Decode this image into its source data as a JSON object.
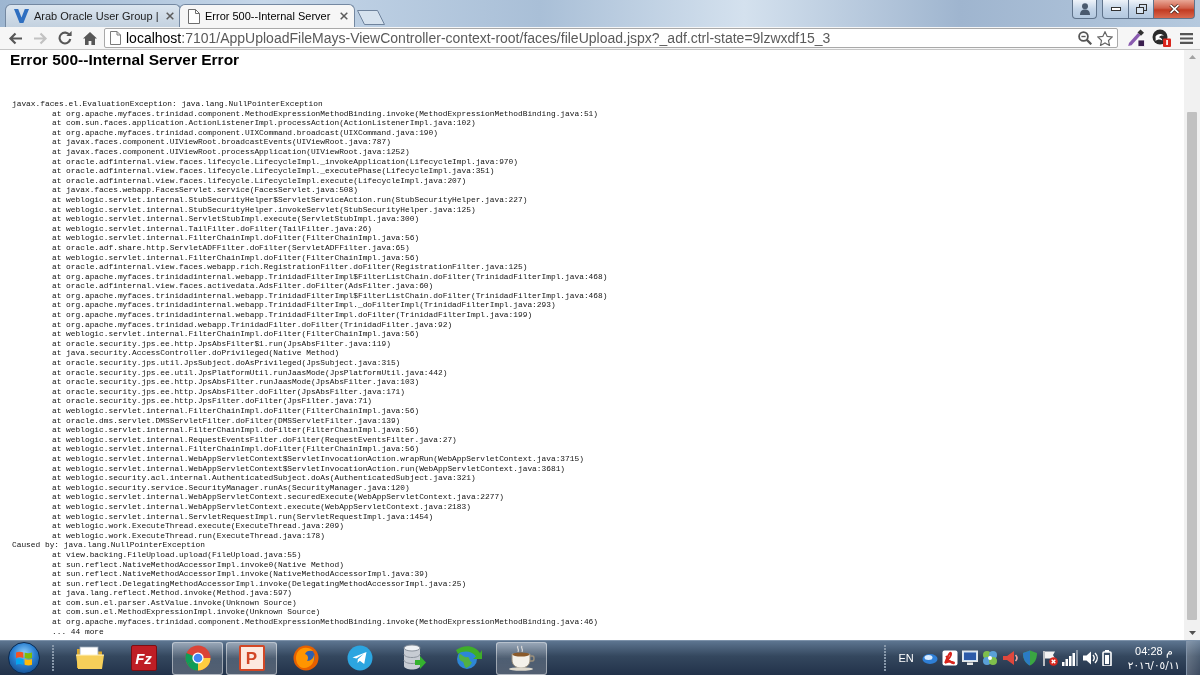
{
  "browser": {
    "tabs": [
      {
        "kind": "site",
        "title": "Arab Oracle User Group |",
        "selected": false
      },
      {
        "kind": "page",
        "title": "Error 500--Internal Server",
        "selected": true
      }
    ],
    "nav_buttons": [
      {
        "kind": "back",
        "disabled": false
      },
      {
        "kind": "forward",
        "disabled": true
      }
    ],
    "address_bar": {
      "host": "localhost",
      "path": ":7101/AppUploadFileMays-ViewController-context-root/faces/fileUpload.jspx?_adf.ctrl-state=9lzwxdf15_3"
    }
  },
  "page": {
    "heading": "Error 500--Internal Server Error",
    "exceptions": [
      {
        "message": "javax.faces.el.EvaluationException: java.lang.NullPointerException",
        "frames": [
          "at org.apache.myfaces.trinidad.component.MethodExpressionMethodBinding.invoke(MethodExpressionMethodBinding.java:51)",
          "at com.sun.faces.application.ActionListenerImpl.processAction(ActionListenerImpl.java:102)",
          "at org.apache.myfaces.trinidad.component.UIXCommand.broadcast(UIXCommand.java:190)",
          "at javax.faces.component.UIViewRoot.broadcastEvents(UIViewRoot.java:787)",
          "at javax.faces.component.UIViewRoot.processApplication(UIViewRoot.java:1252)",
          "at oracle.adfinternal.view.faces.lifecycle.LifecycleImpl._invokeApplication(LifecycleImpl.java:970)",
          "at oracle.adfinternal.view.faces.lifecycle.LifecycleImpl._executePhase(LifecycleImpl.java:351)",
          "at oracle.adfinternal.view.faces.lifecycle.LifecycleImpl.execute(LifecycleImpl.java:207)",
          "at javax.faces.webapp.FacesServlet.service(FacesServlet.java:508)",
          "at weblogic.servlet.internal.StubSecurityHelper$ServletServiceAction.run(StubSecurityHelper.java:227)",
          "at weblogic.servlet.internal.StubSecurityHelper.invokeServlet(StubSecurityHelper.java:125)",
          "at weblogic.servlet.internal.ServletStubImpl.execute(ServletStubImpl.java:300)",
          "at weblogic.servlet.internal.TailFilter.doFilter(TailFilter.java:26)",
          "at weblogic.servlet.internal.FilterChainImpl.doFilter(FilterChainImpl.java:56)",
          "at oracle.adf.share.http.ServletADFFilter.doFilter(ServletADFFilter.java:65)",
          "at weblogic.servlet.internal.FilterChainImpl.doFilter(FilterChainImpl.java:56)",
          "at oracle.adfinternal.view.faces.webapp.rich.RegistrationFilter.doFilter(RegistrationFilter.java:125)",
          "at org.apache.myfaces.trinidadinternal.webapp.TrinidadFilterImpl$FilterListChain.doFilter(TrinidadFilterImpl.java:468)",
          "at oracle.adfinternal.view.faces.activedata.AdsFilter.doFilter(AdsFilter.java:60)",
          "at org.apache.myfaces.trinidadinternal.webapp.TrinidadFilterImpl$FilterListChain.doFilter(TrinidadFilterImpl.java:468)",
          "at org.apache.myfaces.trinidadinternal.webapp.TrinidadFilterImpl._doFilterImpl(TrinidadFilterImpl.java:293)",
          "at org.apache.myfaces.trinidadinternal.webapp.TrinidadFilterImpl.doFilter(TrinidadFilterImpl.java:199)",
          "at org.apache.myfaces.trinidad.webapp.TrinidadFilter.doFilter(TrinidadFilter.java:92)",
          "at weblogic.servlet.internal.FilterChainImpl.doFilter(FilterChainImpl.java:56)",
          "at oracle.security.jps.ee.http.JpsAbsFilter$1.run(JpsAbsFilter.java:119)",
          "at java.security.AccessController.doPrivileged(Native Method)",
          "at oracle.security.jps.util.JpsSubject.doAsPrivileged(JpsSubject.java:315)",
          "at oracle.security.jps.ee.util.JpsPlatformUtil.runJaasMode(JpsPlatformUtil.java:442)",
          "at oracle.security.jps.ee.http.JpsAbsFilter.runJaasMode(JpsAbsFilter.java:103)",
          "at oracle.security.jps.ee.http.JpsAbsFilter.doFilter(JpsAbsFilter.java:171)",
          "at oracle.security.jps.ee.http.JpsFilter.doFilter(JpsFilter.java:71)",
          "at weblogic.servlet.internal.FilterChainImpl.doFilter(FilterChainImpl.java:56)",
          "at oracle.dms.servlet.DMSServletFilter.doFilter(DMSServletFilter.java:139)",
          "at weblogic.servlet.internal.FilterChainImpl.doFilter(FilterChainImpl.java:56)",
          "at weblogic.servlet.internal.RequestEventsFilter.doFilter(RequestEventsFilter.java:27)",
          "at weblogic.servlet.internal.FilterChainImpl.doFilter(FilterChainImpl.java:56)",
          "at weblogic.servlet.internal.WebAppServletContext$ServletInvocationAction.wrapRun(WebAppServletContext.java:3715)",
          "at weblogic.servlet.internal.WebAppServletContext$ServletInvocationAction.run(WebAppServletContext.java:3681)",
          "at weblogic.security.acl.internal.AuthenticatedSubject.doAs(AuthenticatedSubject.java:321)",
          "at weblogic.security.service.SecurityManager.runAs(SecurityManager.java:120)",
          "at weblogic.servlet.internal.WebAppServletContext.securedExecute(WebAppServletContext.java:2277)",
          "at weblogic.servlet.internal.WebAppServletContext.execute(WebAppServletContext.java:2183)",
          "at weblogic.servlet.internal.ServletRequestImpl.run(ServletRequestImpl.java:1454)",
          "at weblogic.work.ExecuteThread.execute(ExecuteThread.java:209)",
          "at weblogic.work.ExecuteThread.run(ExecuteThread.java:178)"
        ]
      },
      {
        "message": "Caused by: java.lang.NullPointerException",
        "frames": [
          "at view.backing.FileUpload.upload(FileUpload.java:55)",
          "at sun.reflect.NativeMethodAccessorImpl.invoke0(Native Method)",
          "at sun.reflect.NativeMethodAccessorImpl.invoke(NativeMethodAccessorImpl.java:39)",
          "at sun.reflect.DelegatingMethodAccessorImpl.invoke(DelegatingMethodAccessorImpl.java:25)",
          "at java.lang.reflect.Method.invoke(Method.java:597)",
          "at com.sun.el.parser.AstValue.invoke(Unknown Source)",
          "at com.sun.el.MethodExpressionImpl.invoke(Unknown Source)",
          "at org.apache.myfaces.trinidad.component.MethodExpressionMethodBinding.invoke(MethodExpressionMethodBinding.java:46)"
        ],
        "more": "... 44 more"
      }
    ]
  },
  "taskbar": {
    "apps": [
      {
        "kind": "folder",
        "running": false
      },
      {
        "kind": "filezilla",
        "glyph": "Fz",
        "running": false
      },
      {
        "kind": "chrome",
        "running": true
      },
      {
        "kind": "powerpoint",
        "glyph": "P",
        "running": true
      },
      {
        "kind": "firefox",
        "running": false
      },
      {
        "kind": "telegram",
        "running": false
      },
      {
        "kind": "database",
        "running": false
      },
      {
        "kind": "globe",
        "running": false
      },
      {
        "kind": "coffee",
        "running": true
      }
    ],
    "tray": {
      "language": "EN",
      "time": "04:28 م",
      "date": "٢٠١٦/٠٥/١١"
    }
  }
}
